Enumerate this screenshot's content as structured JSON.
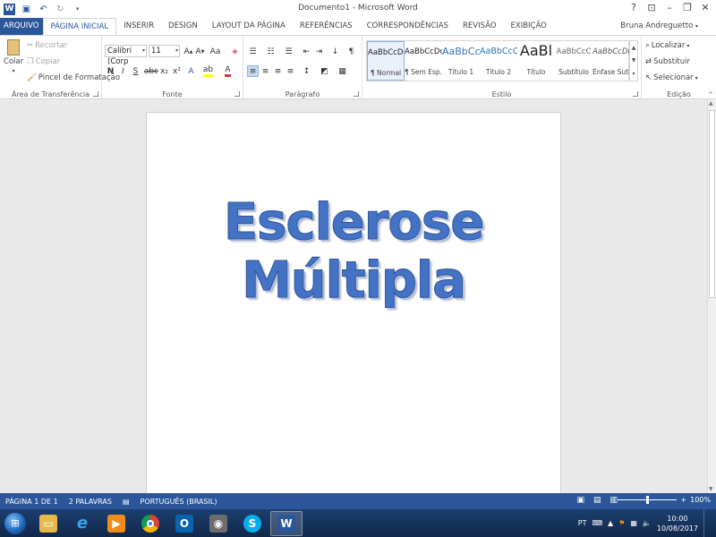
{
  "window": {
    "title": "Documento1 - Microsoft Word",
    "help": "?",
    "min": "–",
    "restore": "❐",
    "close": "✕"
  },
  "qat": {
    "save_icon": "save-icon",
    "undo_icon": "undo-icon",
    "redo_icon": "redo-icon"
  },
  "tabs": [
    {
      "label": "ARQUIVO"
    },
    {
      "label": "PÁGINA INICIAL"
    },
    {
      "label": "INSERIR"
    },
    {
      "label": "DESIGN"
    },
    {
      "label": "LAYOUT DA PÁGINA"
    },
    {
      "label": "REFERÊNCIAS"
    },
    {
      "label": "CORRESPONDÊNCIAS"
    },
    {
      "label": "REVISÃO"
    },
    {
      "label": "EXIBIÇÃO"
    }
  ],
  "user": "Bruna Andreguetto",
  "clipboard": {
    "paste": "Colar",
    "cut": "Recortar",
    "copy": "Copiar",
    "format_painter": "Pincel de Formatação",
    "label": "Área de Transferência"
  },
  "font": {
    "name": "Calibri (Corp",
    "size": "11",
    "bold": "N",
    "italic": "I",
    "underline": "S",
    "strike": "abc",
    "sub": "x₂",
    "sup": "x²",
    "label": "Fonte"
  },
  "paragraph": {
    "label": "Parágrafo"
  },
  "styles": {
    "label": "Estilo",
    "items": [
      {
        "preview": "AaBbCcDc",
        "name": "¶ Normal"
      },
      {
        "preview": "AaBbCcDc",
        "name": "¶ Sem Esp..."
      },
      {
        "preview": "AaBbCc",
        "name": "Título 1"
      },
      {
        "preview": "AaBbCcC",
        "name": "Título 2"
      },
      {
        "preview": "AaBl",
        "name": "Título"
      },
      {
        "preview": "AaBbCcC",
        "name": "Subtítulo"
      },
      {
        "preview": "AaBbCcDı",
        "name": "Ênfase Sutil"
      }
    ]
  },
  "editing": {
    "find": "Localizar",
    "replace": "Substituir",
    "select": "Selecionar",
    "label": "Edição"
  },
  "document": {
    "headline": "Esclerose Múltipla"
  },
  "status": {
    "page": "PÁGINA 1 DE 1",
    "words": "2 PALAVRAS",
    "language": "PORTUGUÊS (BRASIL)",
    "zoom": "100%"
  },
  "tray": {
    "lang": "PT",
    "time": "10:00",
    "date": "10/08/2017"
  },
  "colors": {
    "accent": "#2b579a",
    "headline": "#4472c4"
  }
}
